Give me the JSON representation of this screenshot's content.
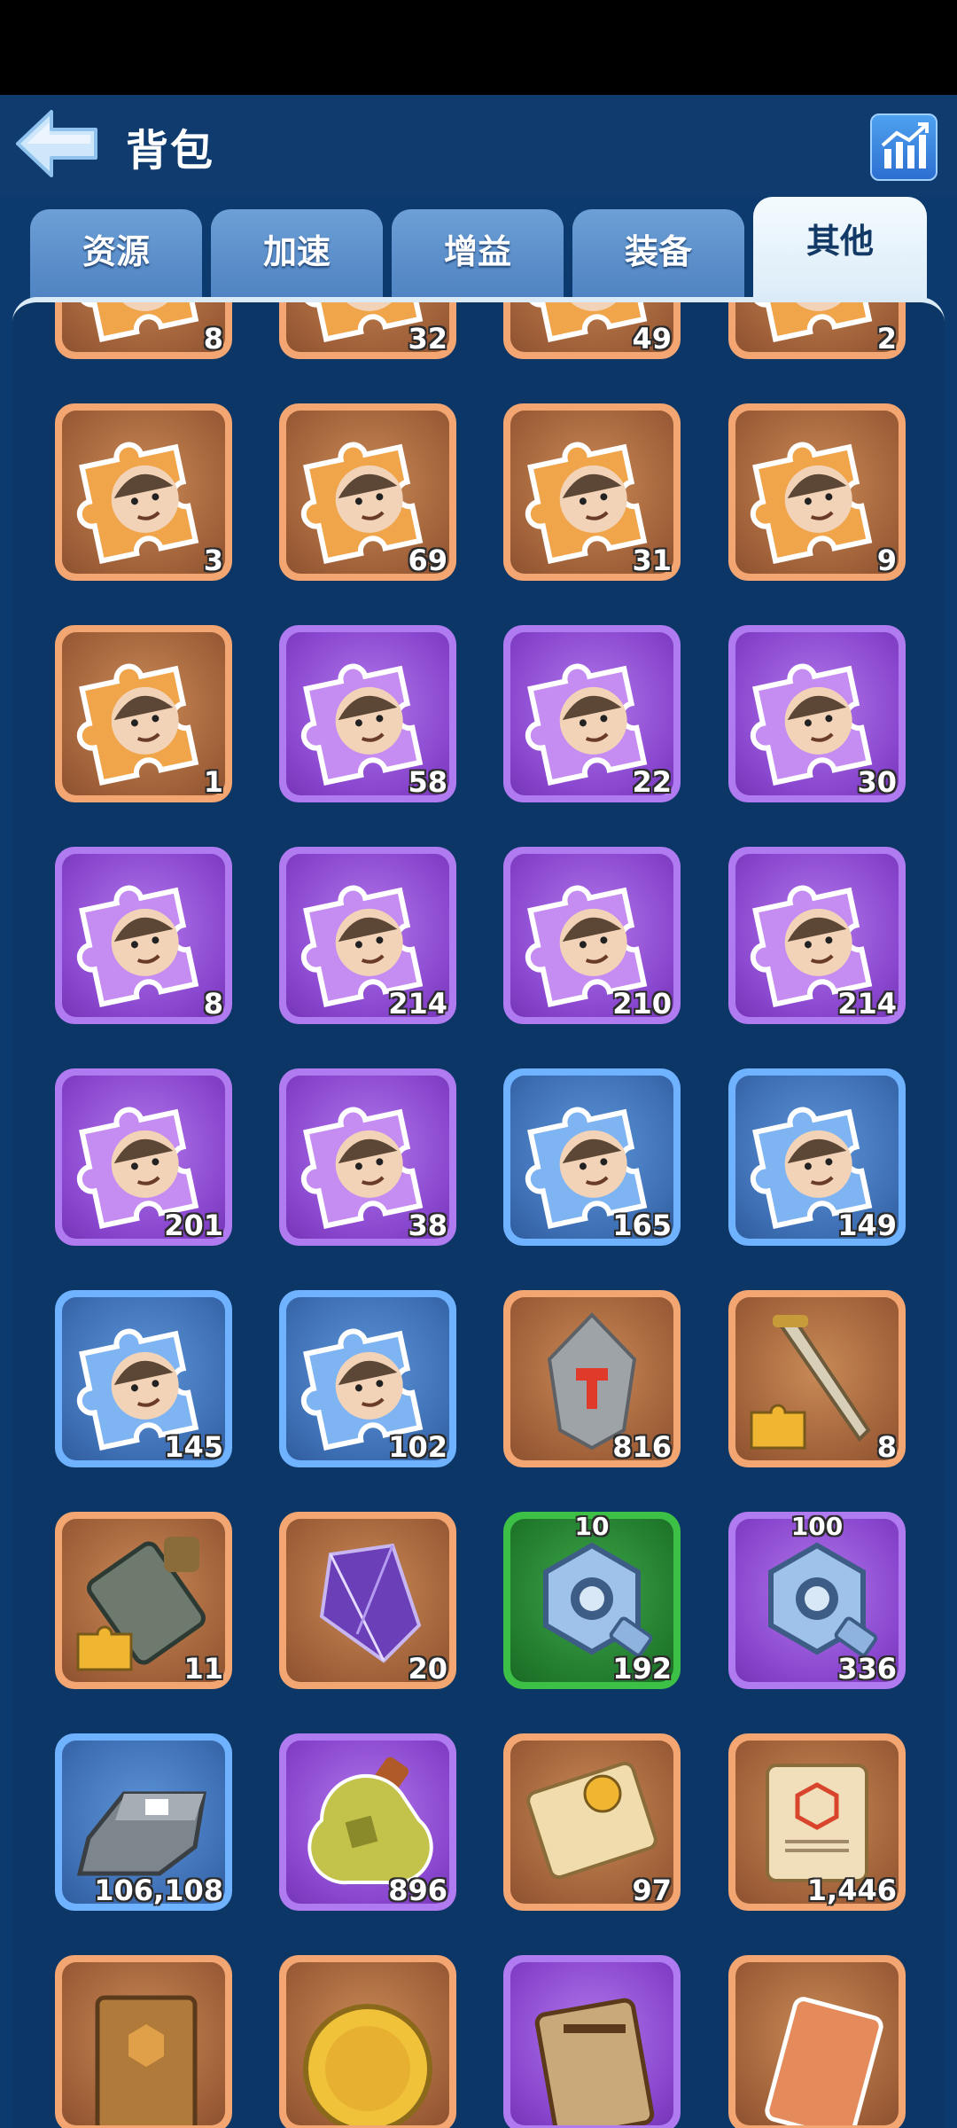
{
  "header": {
    "title": "背包"
  },
  "tabs": [
    {
      "label": "资源"
    },
    {
      "label": "加速"
    },
    {
      "label": "增益"
    },
    {
      "label": "装备"
    },
    {
      "label": "其他",
      "active": true
    }
  ],
  "rows": [
    [
      {
        "kind": "puzzle",
        "rarity": "orange",
        "count": "8"
      },
      {
        "kind": "puzzle",
        "rarity": "orange",
        "count": "32"
      },
      {
        "kind": "puzzle",
        "rarity": "orange",
        "count": "49"
      },
      {
        "kind": "puzzle",
        "rarity": "orange",
        "count": "2"
      }
    ],
    [
      {
        "kind": "puzzle",
        "rarity": "orange",
        "count": "3"
      },
      {
        "kind": "puzzle",
        "rarity": "orange",
        "count": "69"
      },
      {
        "kind": "puzzle",
        "rarity": "orange",
        "count": "31"
      },
      {
        "kind": "puzzle",
        "rarity": "orange",
        "count": "9"
      }
    ],
    [
      {
        "kind": "puzzle",
        "rarity": "orange",
        "count": "1"
      },
      {
        "kind": "puzzle",
        "rarity": "purple",
        "count": "58"
      },
      {
        "kind": "puzzle",
        "rarity": "purple",
        "count": "22"
      },
      {
        "kind": "puzzle",
        "rarity": "purple",
        "count": "30"
      }
    ],
    [
      {
        "kind": "puzzle",
        "rarity": "purple",
        "count": "8"
      },
      {
        "kind": "puzzle",
        "rarity": "purple",
        "count": "214"
      },
      {
        "kind": "puzzle",
        "rarity": "purple",
        "count": "210"
      },
      {
        "kind": "puzzle",
        "rarity": "purple",
        "count": "214"
      }
    ],
    [
      {
        "kind": "puzzle",
        "rarity": "purple",
        "count": "201"
      },
      {
        "kind": "puzzle",
        "rarity": "purple",
        "count": "38"
      },
      {
        "kind": "puzzle",
        "rarity": "blue",
        "count": "165"
      },
      {
        "kind": "puzzle",
        "rarity": "blue",
        "count": "149"
      }
    ],
    [
      {
        "kind": "puzzle",
        "rarity": "blue",
        "count": "145"
      },
      {
        "kind": "puzzle",
        "rarity": "blue",
        "count": "102"
      },
      {
        "kind": "whetstone",
        "rarity": "orange",
        "count": "816"
      },
      {
        "kind": "sword-fragment",
        "rarity": "orange",
        "count": "8"
      }
    ],
    [
      {
        "kind": "armor-fragment",
        "rarity": "orange",
        "count": "11"
      },
      {
        "kind": "crystal",
        "rarity": "orange",
        "count": "20"
      },
      {
        "kind": "bolt",
        "rarity": "green",
        "top": "10",
        "count": "192"
      },
      {
        "kind": "bolt",
        "rarity": "purple",
        "top": "100",
        "count": "336"
      }
    ],
    [
      {
        "kind": "iron-ingot",
        "rarity": "blue",
        "count": "106,108"
      },
      {
        "kind": "potion",
        "rarity": "purple",
        "count": "896"
      },
      {
        "kind": "scroll",
        "rarity": "orange",
        "count": "97"
      },
      {
        "kind": "blueprint",
        "rarity": "orange",
        "count": "1,446"
      }
    ],
    [
      {
        "kind": "book",
        "rarity": "orange",
        "count": ""
      },
      {
        "kind": "gold-coin",
        "rarity": "orange",
        "count": ""
      },
      {
        "kind": "tag",
        "rarity": "purple",
        "count": ""
      },
      {
        "kind": "ticket",
        "rarity": "orange",
        "count": ""
      }
    ]
  ],
  "colors": {
    "background": "#0d3a6e",
    "tab_inactive": "#5b8fcb",
    "tab_active": "#e8f4fb"
  }
}
